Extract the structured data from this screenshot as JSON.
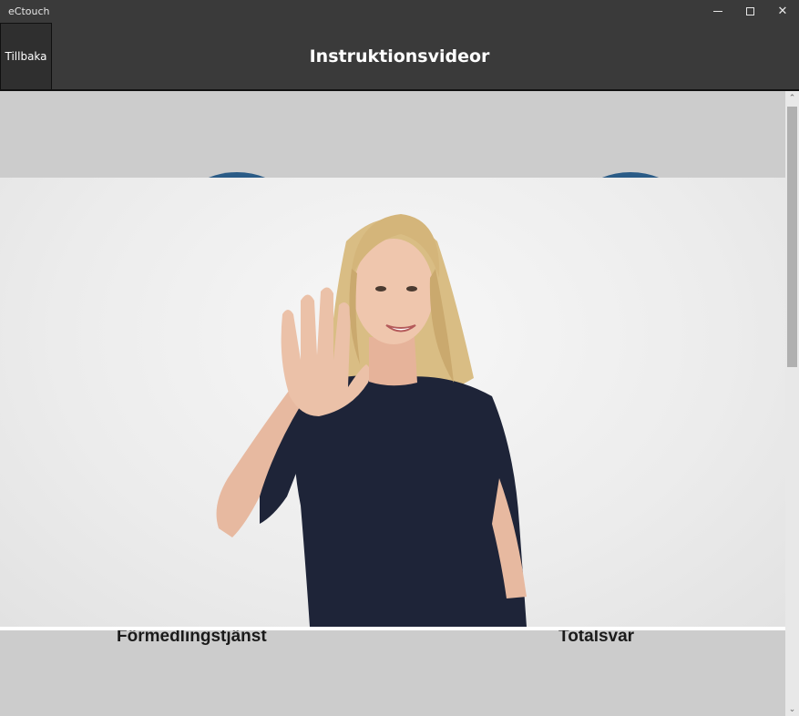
{
  "window": {
    "app_title": "eCtouch",
    "minimize_glyph": "─",
    "close_glyph": "✕"
  },
  "header": {
    "back_label": "Tillbaka",
    "title": "Instruktionsvideor"
  },
  "tiles": [
    {
      "label": "Förmedlingstjänst",
      "icon": "circle-tile-icon"
    },
    {
      "label": "Totalsvar",
      "icon": "circle-tile-icon"
    }
  ],
  "scrollbar": {
    "up_glyph": "⌃",
    "down_glyph": "⌄"
  },
  "colors": {
    "chrome": "#3a3a3a",
    "content_bg": "#cccccc",
    "tile_accent": "#2a5b86"
  }
}
